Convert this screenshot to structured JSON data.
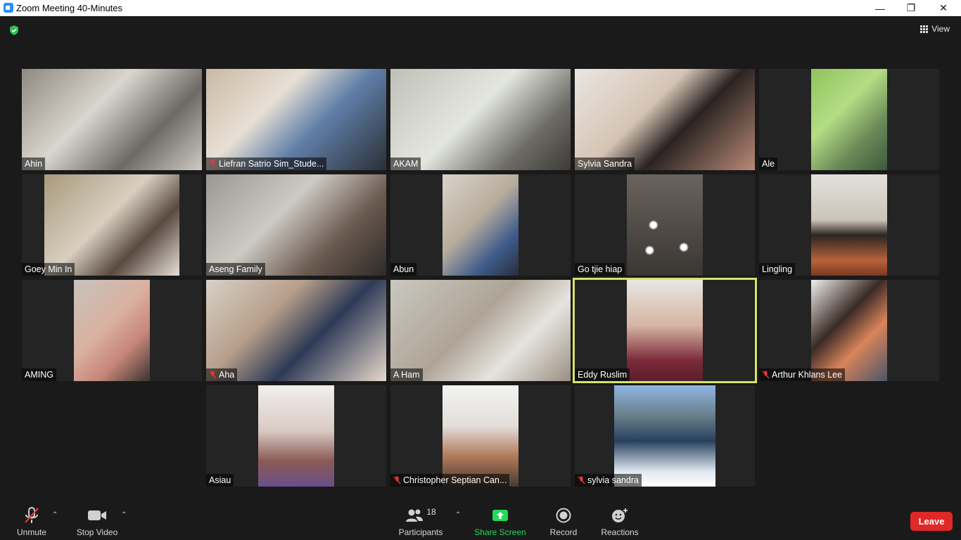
{
  "window": {
    "title": "Zoom Meeting 40-Minutes",
    "minimize": "—",
    "restore": "❐",
    "close": "✕"
  },
  "header": {
    "view_label": "View"
  },
  "participants": [
    {
      "name": "Ahin",
      "muted": false
    },
    {
      "name": "Liefran Satrio Sim_Stude...",
      "muted": true
    },
    {
      "name": "AKAM",
      "muted": false
    },
    {
      "name": "Sylvia Sandra",
      "muted": false
    },
    {
      "name": "Ale",
      "muted": false
    },
    {
      "name": "Goey Min In",
      "muted": false
    },
    {
      "name": "Aseng Family",
      "muted": false
    },
    {
      "name": "Abun",
      "muted": false
    },
    {
      "name": "Go tjie hiap",
      "muted": false
    },
    {
      "name": "Lingling",
      "muted": false
    },
    {
      "name": "AMING",
      "muted": false
    },
    {
      "name": "Aha",
      "muted": true
    },
    {
      "name": "A Ham",
      "muted": false
    },
    {
      "name": "Eddy Ruslim",
      "muted": false,
      "active": true
    },
    {
      "name": "Arthur Khlans Lee",
      "muted": true
    },
    {
      "name": "Asiau",
      "muted": false
    },
    {
      "name": "Christopher Septian Can...",
      "muted": true
    },
    {
      "name": "sylvia sandra",
      "muted": true
    }
  ],
  "toolbar": {
    "unmute": "Unmute",
    "stop_video": "Stop Video",
    "participants_label": "Participants",
    "participants_count": "18",
    "share_screen": "Share Screen",
    "record": "Record",
    "reactions": "Reactions",
    "leave": "Leave"
  },
  "colors": {
    "share_green": "#23d959",
    "leave_red": "#e02828",
    "active_speaker": "#d7e26a"
  }
}
